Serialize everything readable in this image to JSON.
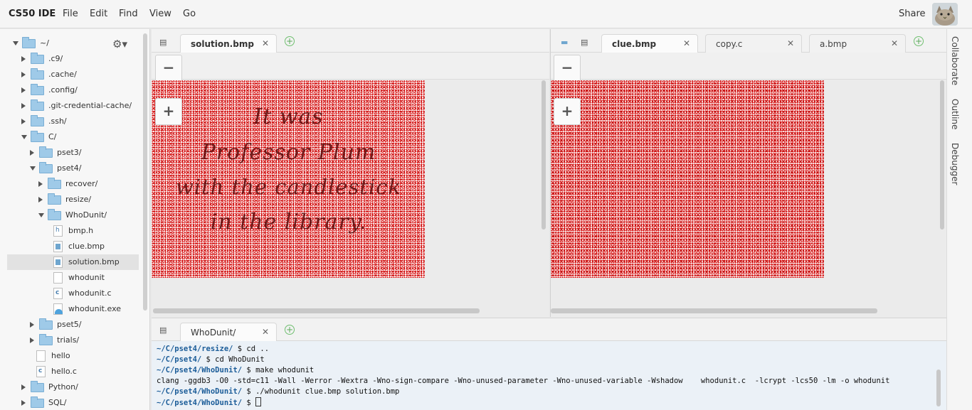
{
  "menubar": {
    "brand": "CS50 IDE",
    "menus": [
      "File",
      "Edit",
      "Find",
      "View",
      "Go"
    ],
    "share": "Share"
  },
  "sidebar": {
    "items": [
      {
        "label": "~/",
        "type": "folder",
        "state": "open"
      },
      {
        "label": ".c9/",
        "type": "folder",
        "state": "closed"
      },
      {
        "label": ".cache/",
        "type": "folder",
        "state": "closed"
      },
      {
        "label": ".config/",
        "type": "folder",
        "state": "closed"
      },
      {
        "label": ".git-credential-cache/",
        "type": "folder",
        "state": "closed"
      },
      {
        "label": ".ssh/",
        "type": "folder",
        "state": "closed"
      },
      {
        "label": "C/",
        "type": "folder",
        "state": "open"
      },
      {
        "label": "pset3/",
        "type": "folder",
        "state": "closed"
      },
      {
        "label": "pset4/",
        "type": "folder",
        "state": "open"
      },
      {
        "label": "recover/",
        "type": "folder",
        "state": "closed"
      },
      {
        "label": "resize/",
        "type": "folder",
        "state": "closed"
      },
      {
        "label": "WhoDunit/",
        "type": "folder",
        "state": "open"
      },
      {
        "label": "bmp.h",
        "type": "file-h"
      },
      {
        "label": "clue.bmp",
        "type": "file-img"
      },
      {
        "label": "solution.bmp",
        "type": "file-img",
        "selected": true
      },
      {
        "label": "whodunit",
        "type": "file"
      },
      {
        "label": "whodunit.c",
        "type": "file-c"
      },
      {
        "label": "whodunit.exe",
        "type": "file-exe"
      },
      {
        "label": "pset5/",
        "type": "folder",
        "state": "closed"
      },
      {
        "label": "trials/",
        "type": "folder",
        "state": "closed"
      },
      {
        "label": "hello",
        "type": "file"
      },
      {
        "label": "hello.c",
        "type": "file-c"
      },
      {
        "label": "Python/",
        "type": "folder",
        "state": "closed"
      },
      {
        "label": "SQL/",
        "type": "folder",
        "state": "closed"
      }
    ]
  },
  "left_pane": {
    "tabs": [
      {
        "label": "solution.bmp",
        "active": true
      }
    ],
    "zoom_out": "−",
    "zoom_in": "+",
    "image_text": [
      "It was",
      "Professor Plum",
      "with the candlestick",
      "in the library."
    ]
  },
  "right_pane": {
    "tabs": [
      {
        "label": "clue.bmp",
        "active": true
      },
      {
        "label": "copy.c",
        "active": false
      },
      {
        "label": "a.bmp",
        "active": false
      }
    ],
    "zoom_out": "−",
    "zoom_in": "+"
  },
  "right_panel": {
    "labels": [
      "Collaborate",
      "Outline",
      "Debugger"
    ]
  },
  "terminal": {
    "tab": "WhoDunit/",
    "lines": [
      {
        "prompt": "~/C/pset4/resize/",
        "text": " $ cd .."
      },
      {
        "prompt": "~/C/pset4/",
        "text": " $ cd WhoDunit"
      },
      {
        "prompt": "~/C/pset4/WhoDunit/",
        "text": " $ make whodunit"
      },
      {
        "prompt": "",
        "text": "clang -ggdb3 -O0 -std=c11 -Wall -Werror -Wextra -Wno-sign-compare -Wno-unused-parameter -Wno-unused-variable -Wshadow    whodunit.c  -lcrypt -lcs50 -lm -o whodunit"
      },
      {
        "prompt": "~/C/pset4/WhoDunit/",
        "text": " $ ./whodunit clue.bmp solution.bmp"
      },
      {
        "prompt": "~/C/pset4/WhoDunit/",
        "text": " $ "
      }
    ]
  },
  "colors": {
    "accent_green": "#5aa85a",
    "folder_blue": "#9fcae8",
    "prompt_blue": "#1c5d99",
    "noise_red": "#d40a0a"
  }
}
